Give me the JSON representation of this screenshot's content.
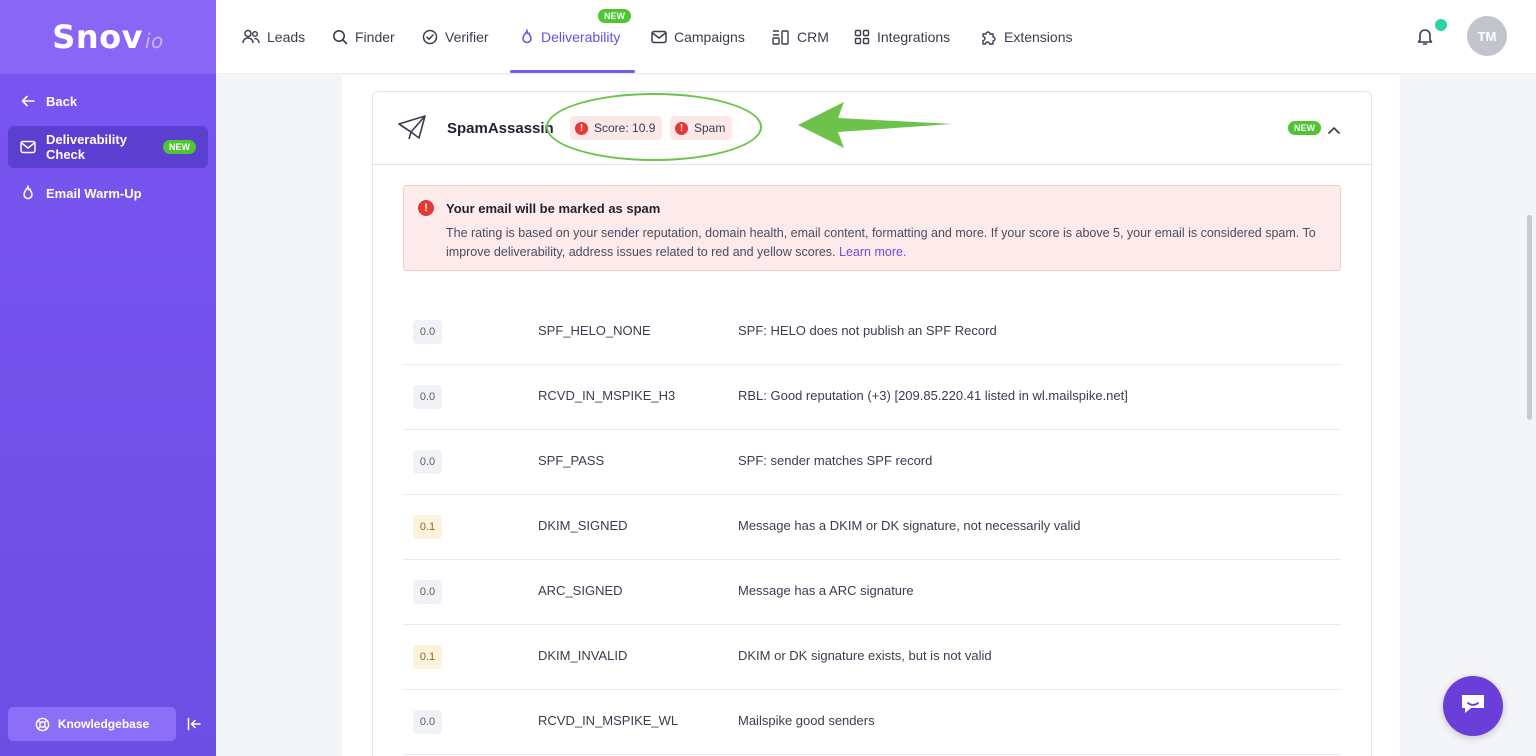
{
  "logo": {
    "main": "Snov",
    "suffix": "io"
  },
  "sidebar": {
    "back_label": "Back",
    "items": [
      {
        "label": "Deliverability Check",
        "badge": "NEW",
        "active": true
      },
      {
        "label": "Email Warm-Up",
        "active": false
      }
    ],
    "knowledgebase_label": "Knowledgebase"
  },
  "topnav": {
    "items": [
      {
        "label": "Leads",
        "icon": "users-icon"
      },
      {
        "label": "Finder",
        "icon": "search-icon"
      },
      {
        "label": "Verifier",
        "icon": "check-circle-icon"
      },
      {
        "label": "Deliverability",
        "icon": "flame-icon",
        "active": true,
        "badge": "NEW"
      },
      {
        "label": "Campaigns",
        "icon": "mail-icon"
      },
      {
        "label": "CRM",
        "icon": "crm-icon"
      },
      {
        "label": "Integrations",
        "icon": "grid-icon"
      },
      {
        "label": "Extensions",
        "icon": "puzzle-icon"
      }
    ],
    "avatar_initials": "TM"
  },
  "card": {
    "title": "SpamAssassin",
    "score_label": "Score: 10.9",
    "status_label": "Spam",
    "badge": "NEW"
  },
  "alert": {
    "title": "Your email will be marked as spam",
    "body": "The rating is based on your sender reputation, domain health, email content, formatting and more. If your score is above 5, your email is considered spam. To improve deliverability, address issues related to red and yellow scores.",
    "link": "Learn more."
  },
  "rules": [
    {
      "score": "0.0",
      "rule": "SPF_HELO_NONE",
      "desc": "SPF: HELO does not publish an SPF Record",
      "level": "neutral"
    },
    {
      "score": "0.0",
      "rule": "RCVD_IN_MSPIKE_H3",
      "desc": "RBL: Good reputation (+3) [209.85.220.41 listed in wl.mailspike.net]",
      "level": "neutral"
    },
    {
      "score": "0.0",
      "rule": "SPF_PASS",
      "desc": "SPF: sender matches SPF record",
      "level": "neutral"
    },
    {
      "score": "0.1",
      "rule": "DKIM_SIGNED",
      "desc": "Message has a DKIM or DK signature, not necessarily valid",
      "level": "warn"
    },
    {
      "score": "0.0",
      "rule": "ARC_SIGNED",
      "desc": "Message has a ARC signature",
      "level": "neutral"
    },
    {
      "score": "0.1",
      "rule": "DKIM_INVALID",
      "desc": "DKIM or DK signature exists, but is not valid",
      "level": "warn"
    },
    {
      "score": "0.0",
      "rule": "RCVD_IN_MSPIKE_WL",
      "desc": "Mailspike good senders",
      "level": "neutral"
    }
  ],
  "colors": {
    "brand": "#7b55f2",
    "accent": "#6c4de6",
    "new_badge": "#4fc531",
    "error": "#e53935",
    "annotation": "#6cc24a"
  }
}
